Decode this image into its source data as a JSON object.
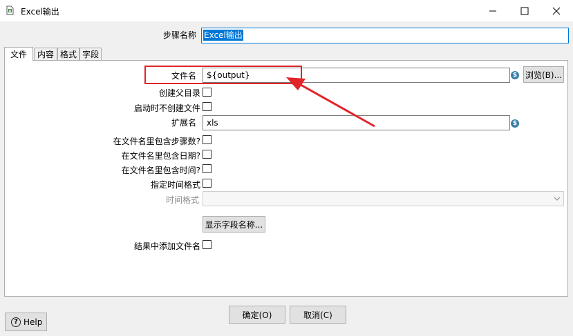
{
  "window": {
    "title": "Excel输出",
    "minimize": "—",
    "maximize": "☐",
    "close": "✕"
  },
  "step_name": {
    "label": "步骤名称",
    "value": "Excel输出"
  },
  "tabs": [
    {
      "label": "文件",
      "active": true
    },
    {
      "label": "内容",
      "active": false
    },
    {
      "label": "格式",
      "active": false
    },
    {
      "label": "字段",
      "active": false
    }
  ],
  "file_tab": {
    "filename_label": "文件名",
    "filename_value": "${output}",
    "browse_label": "浏览(B)...",
    "create_parent_label": "创建父目录",
    "no_create_on_start_label": "启动时不创建文件",
    "extension_label": "扩展名",
    "extension_value": "xls",
    "include_stepnr_label": "在文件名里包含步骤数?",
    "include_date_label": "在文件名里包含日期?",
    "include_time_label": "在文件名里包含时间?",
    "specify_time_format_label": "指定时间格式",
    "time_format_label": "时间格式",
    "time_format_value": "",
    "show_fields_label": "显示字段名称...",
    "add_to_result_label": "结果中添加文件名"
  },
  "variable_icon": "$",
  "footer": {
    "ok_label": "确定(O)",
    "cancel_label": "取消(C)",
    "help_label": "Help"
  },
  "colors": {
    "annotation": "#e0252b",
    "selection": "#0078d7",
    "variable_icon": "#3b7fa8"
  },
  "icons": [
    "app-icon",
    "variable-icon",
    "help-icon",
    "chevron-down-icon",
    "arrow-annotation"
  ]
}
